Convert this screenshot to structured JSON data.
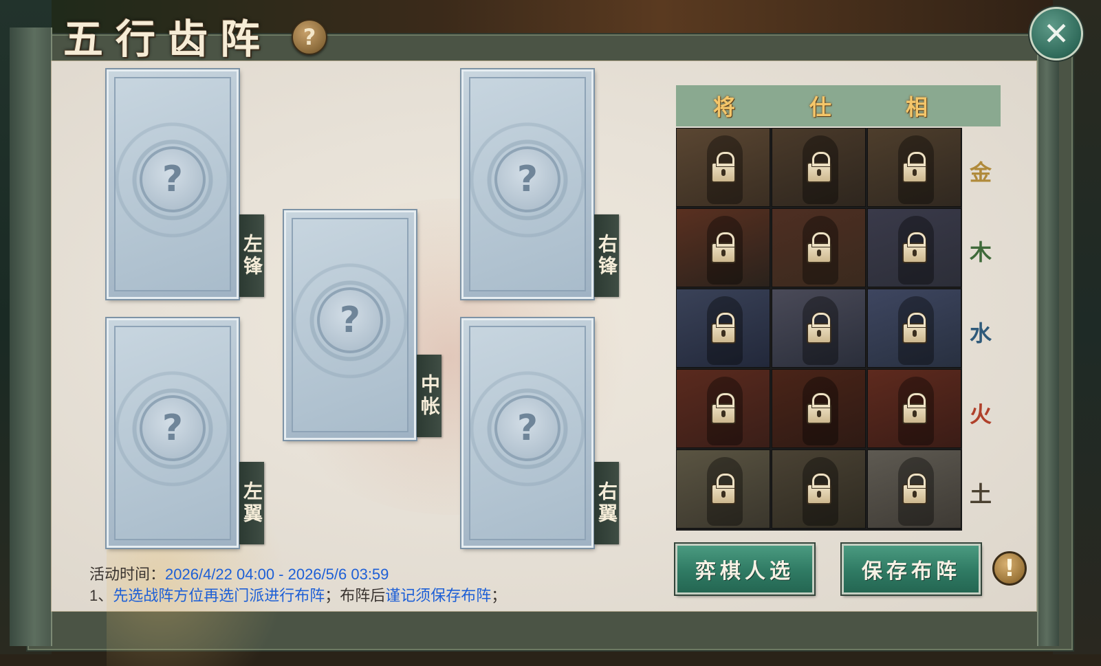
{
  "title": "五行齿阵",
  "help_icon": "question-mark-icon",
  "close_icon": "close-x-icon",
  "slots": [
    {
      "id": "left-vanguard",
      "label": "左锋"
    },
    {
      "id": "right-vanguard",
      "label": "右锋"
    },
    {
      "id": "center-tent",
      "label": "中帐"
    },
    {
      "id": "left-wing",
      "label": "左翼"
    },
    {
      "id": "right-wing",
      "label": "右翼"
    }
  ],
  "empty_slot_glyph": "?",
  "roster": {
    "columns": [
      "将",
      "仕",
      "相"
    ],
    "elements": [
      {
        "name": "金",
        "color": "#b08a3a"
      },
      {
        "name": "木",
        "color": "#3f6a3a"
      },
      {
        "name": "水",
        "color": "#2f5a7a"
      },
      {
        "name": "火",
        "color": "#b0402a"
      },
      {
        "name": "土",
        "color": "#4a4030"
      }
    ],
    "locked": true
  },
  "buttons": {
    "pick_player": "弈棋人选",
    "save_formation": "保存布阵",
    "warning_glyph": "!"
  },
  "info": {
    "time_label": "活动时间：",
    "time_value": "2026/4/22 04:00 - 2026/5/6 03:59",
    "rule_prefix": "1、",
    "rule_part1": "先选战阵方位再选门派进行布阵",
    "rule_part2": "；布阵后",
    "rule_part3": "谨记须保存布阵",
    "rule_part4": "；"
  }
}
